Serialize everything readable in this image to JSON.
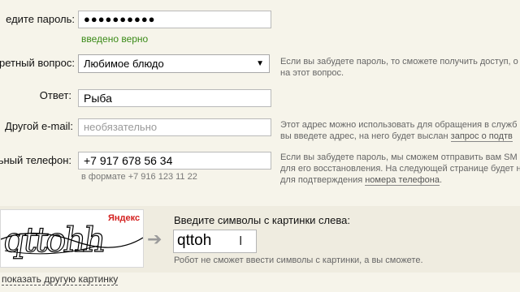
{
  "password": {
    "label": "едите пароль:",
    "value": "●●●●●●●●●●",
    "status": "введено верно"
  },
  "secret_question": {
    "label": "ретный вопрос:",
    "selected": "Любимое блюдо",
    "hint_line1": "Если вы забудете пароль, то сможете получить доступ, о",
    "hint_line2": "на этот вопрос."
  },
  "answer": {
    "label": "Ответ:",
    "value": "Рыба"
  },
  "other_email": {
    "label": "Другой e-mail:",
    "placeholder": "необязательно",
    "hint_line1": "Этот адрес можно использовать для обращения в служб",
    "hint_line2_prefix": "вы введете адрес, на него будет выслан ",
    "hint_line2_link": "запрос о подтв"
  },
  "phone": {
    "label": "ьный телефон:",
    "value": "+7 917 678 56 34",
    "format": "в формате +7 916 123 11 22",
    "hint_line1": "Если вы забудете пароль, мы сможем отправить вам SM",
    "hint_line2": "для его восстановления. На следующей странице будет н",
    "hint_line3_prefix": "для подтверждения ",
    "hint_line3_link": "номера телефона",
    "hint_line3_suffix": "."
  },
  "captcha": {
    "brand": "Яндекс",
    "image_text": "qttohh",
    "label": "Введите символы с картинки слева:",
    "value": "qttoh",
    "note": "Робот не сможет ввести символы с картинки, а вы сможете.",
    "refresh_link": "показать другую картинку"
  },
  "colors": {
    "background": "#f6f4ea",
    "ok_green": "#3a8a17"
  }
}
